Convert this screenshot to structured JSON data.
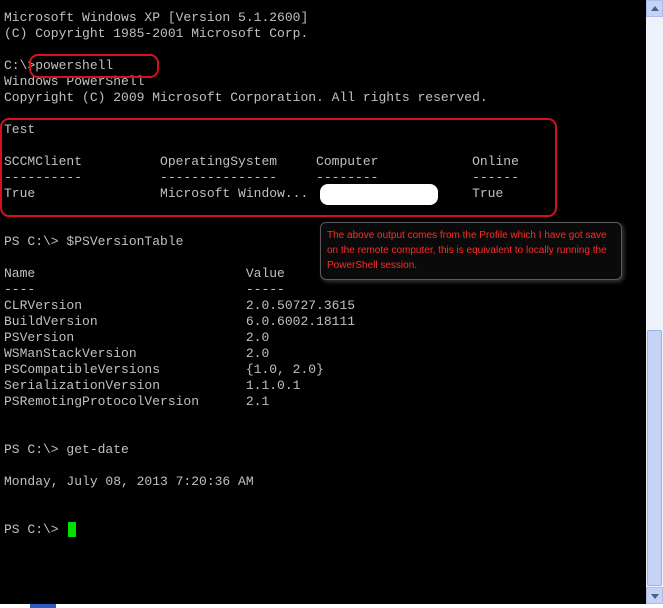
{
  "console": {
    "lines": [
      "Microsoft Windows XP [Version 5.1.2600]",
      "(C) Copyright 1985-2001 Microsoft Corp.",
      "",
      "C:\\>powershell",
      "Windows PowerShell",
      "Copyright (C) 2009 Microsoft Corporation. All rights reserved.",
      "",
      "Test",
      "",
      "SCCMClient          OperatingSystem     Computer            Online",
      "----------          ---------------     --------            ------",
      "True                Microsoft Window...                     True",
      "",
      "",
      "PS C:\\> $PSVersionTable",
      "",
      "Name                           Value",
      "----                           -----",
      "CLRVersion                     2.0.50727.3615",
      "BuildVersion                   6.0.6002.18111",
      "PSVersion                      2.0",
      "WSManStackVersion              2.0",
      "PSCompatibleVersions           {1.0, 2.0}",
      "SerializationVersion           1.1.0.1",
      "PSRemotingProtocolVersion      2.1",
      "",
      "",
      "PS C:\\> get-date",
      "",
      "Monday, July 08, 2013 7:20:36 AM",
      "",
      "",
      "PS C:\\> "
    ]
  },
  "annotation": {
    "callout_text": "The above output comes from the Profile which I have got save on the remote computer, this is equivalent to locally running the PowerShell session."
  },
  "colors": {
    "console_text": "#c0c0c0",
    "console_bg": "#000000",
    "highlight_border": "#d6101e",
    "callout_text": "#ff2a2a",
    "cursor": "#00e000"
  }
}
